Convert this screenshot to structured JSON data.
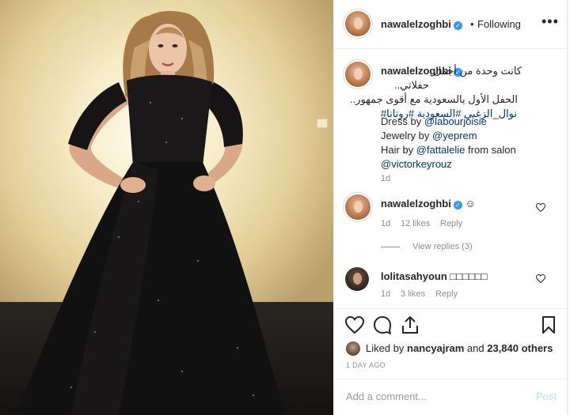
{
  "post": {
    "username": "nawalelzoghbi",
    "follow_status": "Following",
    "more_label": "•••",
    "verified_mark": "✓",
    "dot": "•"
  },
  "caption": {
    "username": "nawalelzoghbi",
    "arabic_line1": "كانت وحدة من أجمل",
    "arabic_line2": "حفلاتي..",
    "arabic_line3": "الحفل الأول بالسعودية مع أقوى جمهور..",
    "hashtags": "نوال_الزغبي #السعودية #روتانا#",
    "dress_prefix": "Dress by ",
    "dress_handle": "@labourjoisie",
    "jewelry_prefix": "Jewelry by ",
    "jewelry_handle": "@yeprem",
    "hair_prefix": "Hair by ",
    "hair_handle": "@fattalelie",
    "hair_suffix": " from salon",
    "salon_handle": "@victorkeyrouz",
    "time": "1d"
  },
  "comments": [
    {
      "username": "nawalelzoghbi",
      "text": "☺",
      "time": "1d",
      "likes": "12 likes",
      "reply": "Reply",
      "icon": "heart-outline-icon"
    },
    {
      "username": "lolitasahyoun",
      "text": "□□□□□□",
      "time": "1d",
      "likes": "3 likes",
      "reply": "Reply",
      "icon": "heart-outline-icon"
    }
  ],
  "view_replies": "View replies (3)",
  "actions": {
    "icons": [
      "heart-icon",
      "comment-icon",
      "share-icon",
      "bookmark-icon"
    ]
  },
  "likes": {
    "prefix": "Liked by ",
    "user": "nancyajram",
    "middle": " and ",
    "count": "23,840 others"
  },
  "time_ago": "1 DAY AGO",
  "add_comment": {
    "placeholder": "Add a comment...",
    "post_label": "Post"
  },
  "colors": {
    "link": "#003569",
    "verified": "#3897f0",
    "muted": "#8e8e8e",
    "post_disabled": "#b2dffc"
  }
}
